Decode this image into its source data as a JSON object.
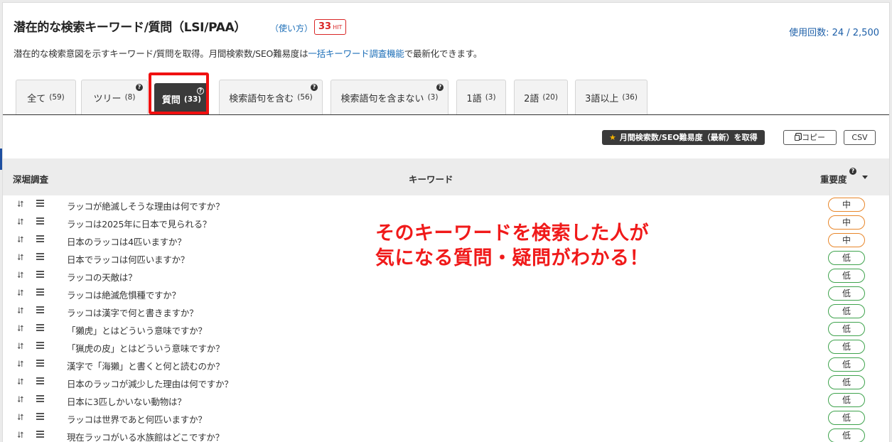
{
  "header": {
    "title": "潜在的な検索キーワード/質問（LSI/PAA）",
    "howto_link": "（使い方）",
    "hit_count": "33",
    "hit_label": "HIT",
    "usage": "使用回数: 24 / 2,500"
  },
  "description": {
    "before": "潜在的な検索意図を示すキーワード/質問を取得。月間検索数/SEO難易度は",
    "link": "一括キーワード調査機能",
    "after": "で最新化できます。"
  },
  "tabs": [
    {
      "label": "全て",
      "count": "(59)"
    },
    {
      "label": "ツリー",
      "count": "(8)"
    },
    {
      "label": "質問",
      "count": "(33)",
      "active": true
    },
    {
      "label": "検索語句を含む",
      "count": "(56)"
    },
    {
      "label": "検索語句を含まない",
      "count": "(3)"
    },
    {
      "label": "1語",
      "count": "(3)"
    },
    {
      "label": "2語",
      "count": "(20)"
    },
    {
      "label": "3語以上",
      "count": "(36)"
    }
  ],
  "toolbar": {
    "fetch_label": "月間検索数/SEO難易度（最新）を取得",
    "copy_label": "コピー",
    "csv_label": "CSV"
  },
  "table": {
    "col_research": "深堀調査",
    "col_keyword": "キーワード",
    "col_importance": "重要度",
    "rows": [
      {
        "keyword": "ラッコが絶滅しそうな理由は何ですか？",
        "importance": "中"
      },
      {
        "keyword": "ラッコは2025年に日本で見られる？",
        "importance": "中"
      },
      {
        "keyword": "日本のラッコは4匹いますか？",
        "importance": "中"
      },
      {
        "keyword": "日本でラッコは何匹いますか？",
        "importance": "低"
      },
      {
        "keyword": "ラッコの天敵は？",
        "importance": "低"
      },
      {
        "keyword": "ラッコは絶滅危惧種ですか？",
        "importance": "低"
      },
      {
        "keyword": "ラッコは漢字で何と書きますか？",
        "importance": "低"
      },
      {
        "keyword": "「獺虎」とはどういう意味ですか？",
        "importance": "低"
      },
      {
        "keyword": "「猟虎の皮」とはどういう意味ですか？",
        "importance": "低"
      },
      {
        "keyword": "漢字で「海獺」と書くと何と読むのか？",
        "importance": "低"
      },
      {
        "keyword": "日本のラッコが減少した理由は何ですか？",
        "importance": "低"
      },
      {
        "keyword": "日本に3匹しかいない動物は？",
        "importance": "低"
      },
      {
        "keyword": "ラッコは世界であと何匹いますか？",
        "importance": "低"
      },
      {
        "keyword": "現在ラッコがいる水族館はどこですか？",
        "importance": "低"
      }
    ]
  },
  "annotation": {
    "line1": "そのキーワードを検索した人が",
    "line2": "気になる質問・疑問がわかる！"
  },
  "colors": {
    "accent_red": "#f01010",
    "link_blue": "#1d6fb8",
    "badge_mid": "#e8862a",
    "badge_low": "#3fa34d"
  },
  "icons": {
    "row_action_1": "retweet-icon",
    "row_action_2": "menu-icon",
    "star": "star-icon",
    "copy": "copy-icon",
    "help": "question-circle-icon",
    "sort": "caret-down-icon"
  }
}
